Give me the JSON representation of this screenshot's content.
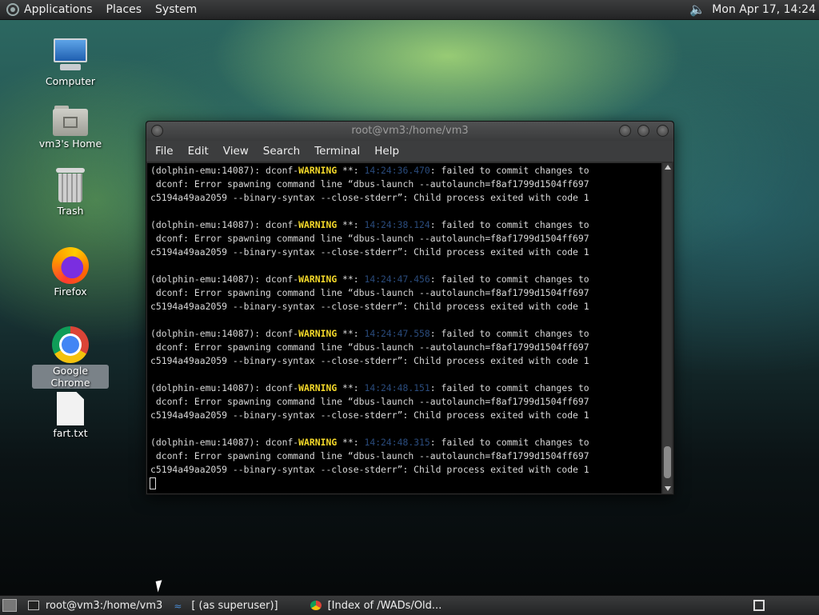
{
  "top_panel": {
    "menus": [
      "Applications",
      "Places",
      "System"
    ],
    "clock": "Mon Apr 17, 14:24"
  },
  "desktop": {
    "icons": [
      {
        "label": "Computer",
        "icon": "computer-icon"
      },
      {
        "label": "vm3's Home",
        "icon": "home-folder-icon"
      },
      {
        "label": "Trash",
        "icon": "trash-icon"
      },
      {
        "label": "Firefox",
        "icon": "firefox-icon"
      },
      {
        "label": "Google Chrome",
        "icon": "chrome-icon"
      },
      {
        "label": "fart.txt",
        "icon": "text-file-icon"
      }
    ]
  },
  "terminal": {
    "title": "root@vm3:/home/vm3",
    "menus": [
      "File",
      "Edit",
      "View",
      "Search",
      "Terminal",
      "Help"
    ],
    "entries": [
      {
        "ts": "14:24:36.470"
      },
      {
        "ts": "14:24:38.124"
      },
      {
        "ts": "14:24:47.456"
      },
      {
        "ts": "14:24:47.558"
      },
      {
        "ts": "14:24:48.151"
      },
      {
        "ts": "14:24:48.315"
      }
    ],
    "line_prefix": "(dolphin-emu:14087): dconf-",
    "warning_word": "WARNING",
    "warning_sep": " **: ",
    "line_suffix": ": failed to commit changes to",
    "line2": " dconf: Error spawning command line “dbus-launch --autolaunch=f8af1799d1504ff697",
    "line3": "c5194a49aa2059 --binary-syntax --close-stderr”: Child process exited with code 1"
  },
  "taskbar": {
    "tasks": [
      {
        "label": "root@vm3:/home/vm3",
        "icon": "terminal-icon"
      },
      {
        "label": "[ (as superuser)]",
        "icon": "app-icon"
      },
      {
        "label": "[Index of /WADs/Old...",
        "icon": "chrome-icon"
      }
    ]
  },
  "colors": {
    "warning": "#f5d92a",
    "timestamp": "#2a4b7c",
    "terminal_bg": "#000000"
  }
}
